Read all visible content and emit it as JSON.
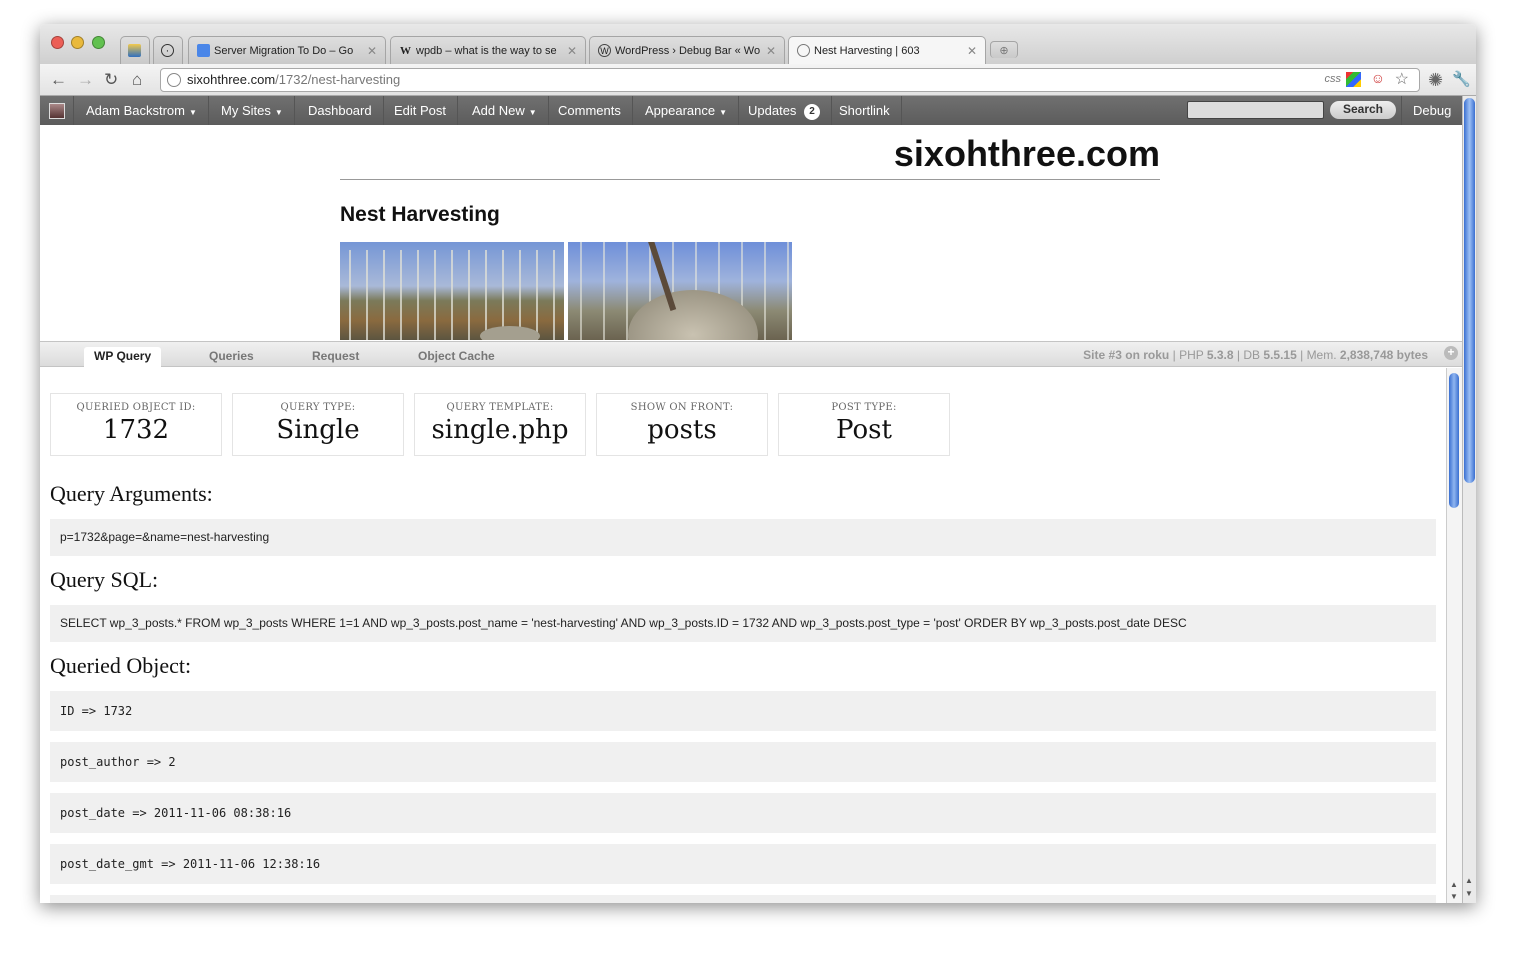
{
  "browser": {
    "tabs": [
      {
        "icon": "gallery-icon",
        "title": ""
      },
      {
        "icon": "clock-icon",
        "title": ""
      },
      {
        "icon": "docs-icon",
        "title": "Server Migration To Do – Go"
      },
      {
        "icon": "wikipedia-icon",
        "title": "wpdb – what is the way to se"
      },
      {
        "icon": "wordpress-icon",
        "title": "WordPress › Debug Bar « Wo"
      },
      {
        "icon": "globe-icon",
        "title": "Nest Harvesting | 603"
      }
    ],
    "url_host": "sixohthree.com",
    "url_path": "/1732/nest-harvesting",
    "css_badge": "css"
  },
  "adminbar": {
    "user": "Adam Backstrom",
    "my_sites": "My Sites",
    "dashboard": "Dashboard",
    "edit_post": "Edit Post",
    "add_new": "Add New",
    "comments": "Comments",
    "appearance": "Appearance",
    "updates": "Updates",
    "updates_count": "2",
    "shortlink": "Shortlink",
    "search_button": "Search",
    "debug": "Debug"
  },
  "site": {
    "title": "sixohthree.com",
    "post_title": "Nest Harvesting"
  },
  "debug_bar": {
    "tabs": [
      "WP Query",
      "Queries",
      "Request",
      "Object Cache"
    ],
    "status": {
      "site_prefix": "Site",
      "site_num": "#3",
      "site_suffix": "on",
      "host": "roku",
      "php_label": "PHP",
      "php": "5.3.8",
      "db_label": "DB",
      "db": "5.5.15",
      "mem_label": "Mem.",
      "mem": "2,838,748",
      "mem_unit": "bytes"
    },
    "boxes": [
      {
        "label": "QUERIED OBJECT ID:",
        "value": "1732"
      },
      {
        "label": "QUERY TYPE:",
        "value": "Single"
      },
      {
        "label": "QUERY TEMPLATE:",
        "value": "single.php"
      },
      {
        "label": "SHOW ON FRONT:",
        "value": "posts"
      },
      {
        "label": "POST TYPE:",
        "value": "Post"
      }
    ],
    "query_args_heading": "Query Arguments:",
    "query_args": "p=1732&page=&name=nest-harvesting",
    "query_sql_heading": "Query SQL:",
    "query_sql": "SELECT wp_3_posts.* FROM wp_3_posts WHERE 1=1 AND wp_3_posts.post_name = 'nest-harvesting' AND wp_3_posts.ID = 1732 AND wp_3_posts.post_type = 'post' ORDER BY wp_3_posts.post_date DESC",
    "queried_object_heading": "Queried Object:",
    "queried_object": [
      "ID => 1732",
      "post_author => 2",
      "post_date => 2011-11-06 08:38:16",
      "post_date_gmt => 2011-11-06 12:38:16"
    ]
  },
  "colors": {
    "admin_bar": "#656565",
    "panel_bg": "#f0f0f0",
    "sky": "#6f8fd8"
  }
}
